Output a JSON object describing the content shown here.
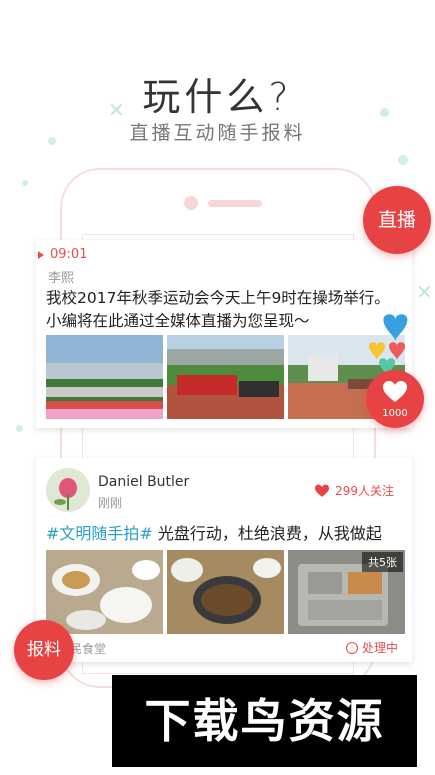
{
  "header": {
    "title": "玩什么?",
    "subtitle": "直播互动随手报料"
  },
  "live_button": {
    "label": "直播"
  },
  "report_button": {
    "label": "报料"
  },
  "live_post": {
    "time": "09:01",
    "author": "李熙",
    "text": "我校2017年秋季运动会今天上午9时在操场举行。小编将在此通过全媒体直播为您呈现～",
    "like_count": "1000"
  },
  "report_post": {
    "user_name": "Daniel Butler",
    "user_time": "刚刚",
    "follow_count": "299人关注",
    "hashtag": "#文明随手拍#",
    "text": " 光盘行动，杜绝浪费，从我做起",
    "photo_count": "共5张",
    "location": "民食堂",
    "status": "处理中"
  },
  "colors": {
    "accent": "#e84344",
    "hashtag": "#2aa0c8"
  },
  "icons": [
    "heart-icon",
    "clock-icon",
    "play-triangle-icon"
  ],
  "watermark": {
    "text": "下载鸟资源"
  }
}
